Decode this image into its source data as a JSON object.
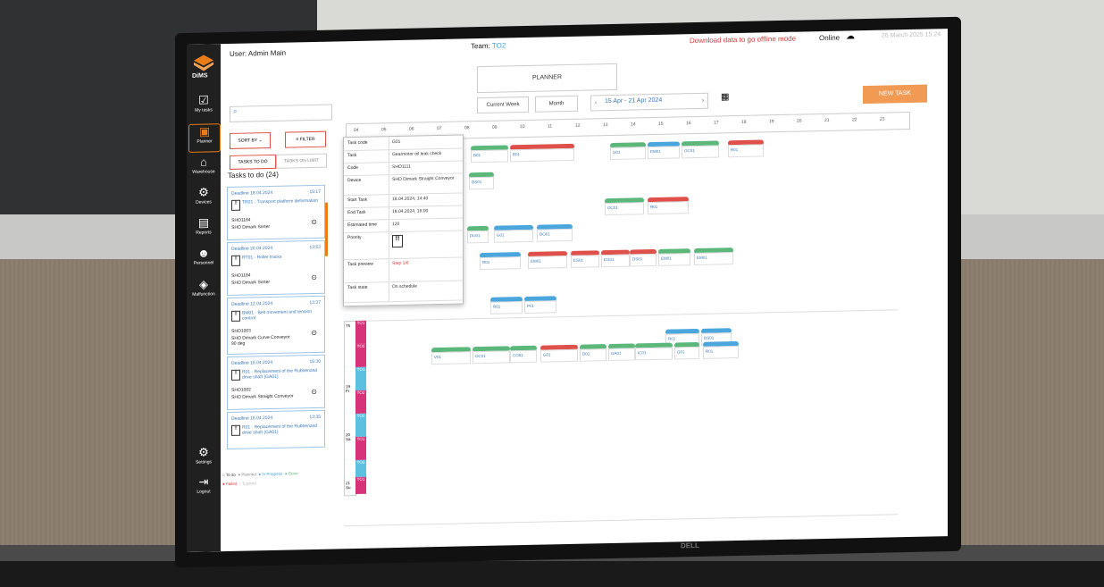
{
  "app": {
    "logo_text": "DiMS",
    "user": "User: Admin Main",
    "team_label": "Team:",
    "team_value": "TO2",
    "offline_text": "Download data to go offline mode",
    "online_text": "Online",
    "datetime": "26 March 2025 15:24",
    "brand_color": "#e97d1a"
  },
  "nav": [
    {
      "label": "My tasks",
      "icon": "checklist-icon"
    },
    {
      "label": "Planner",
      "icon": "calendar-icon"
    },
    {
      "label": "Warehouse",
      "icon": "warehouse-icon"
    },
    {
      "label": "Devices",
      "icon": "gears-icon"
    },
    {
      "label": "Reports",
      "icon": "document-icon"
    },
    {
      "label": "Personnel",
      "icon": "people-icon"
    },
    {
      "label": "Malfunction",
      "icon": "warning-icon"
    },
    {
      "label": "Settings",
      "icon": "gear-icon"
    },
    {
      "label": "Logout",
      "icon": "logout-icon"
    }
  ],
  "toolbar": {
    "planner_tab": "PLANNER",
    "current_week": "Current Week",
    "month": "Month",
    "range": "15 Apr - 21 Apr 2024",
    "new_task": "NEW TASK"
  },
  "left": {
    "sort_by": "SORT BY",
    "filter": "FILTER",
    "tab_todo": "TASKS TO DO",
    "tab_nolimit": "TASKS ON LIMIT",
    "tasks_heading": "Tasks to do (24)",
    "cards": [
      {
        "deadline": "Deadline 18.04.2024",
        "time": "15:17",
        "title": "TR01 - Transport platform deformation",
        "code": "SHO1184",
        "device": "SHO Dimark Sorter"
      },
      {
        "deadline": "Deadline 20.04.2024",
        "time": "13:53",
        "title": "RT01 - Roller tracks",
        "code": "SHO1184",
        "device": "SHO Dimark Sorter"
      },
      {
        "deadline": "Deadline 12.04.2024",
        "time": "13:37",
        "title": "BM01 - Belt movement and tension control",
        "code": "SHO1003",
        "device": "SHO Dimark Curve Conveyor 90 deg"
      },
      {
        "deadline": "Deadline 15.04.2024",
        "time": "16:30",
        "title": "R01 - Replacement of the Rubberized drive shaft (GA01)",
        "code": "SHO1002",
        "device": "SHO Dimark Straight Conveyor"
      },
      {
        "deadline": "Deadline 16.04.2024",
        "time": "13:35",
        "title": "R01 - Replacement of the Rubberized drive shaft (GA01)",
        "code": "",
        "device": ""
      }
    ],
    "legend": [
      "To do",
      "Planned",
      "In Progress",
      "Done",
      "Failed",
      "Expired"
    ]
  },
  "hours": [
    "04",
    "05",
    "06",
    "07",
    "08",
    "09",
    "10",
    "11",
    "12",
    "13",
    "14",
    "15",
    "16",
    "17",
    "18",
    "19",
    "20",
    "21",
    "22",
    "23"
  ],
  "popover": {
    "rows": [
      {
        "k": "Task code",
        "v": "G01"
      },
      {
        "k": "Task",
        "v": "Gearmotor oil leak check"
      },
      {
        "k": "Code",
        "v": "SHO1111"
      },
      {
        "k": "Device",
        "v": "SHO Dimark Straight Conveyor"
      },
      {
        "k": "Start Task",
        "v": "18.04.2024, 14:40"
      },
      {
        "k": "End Task",
        "v": "18.04.2024, 16:00"
      },
      {
        "k": "Estimated time",
        "v": "120"
      },
      {
        "k": "Priority",
        "v": ""
      },
      {
        "k": "Task preview",
        "v": "Step 1/6"
      },
      {
        "k": "Task state",
        "v": "On schedule"
      }
    ]
  },
  "blocks": [
    {
      "t": "B01"
    },
    {
      "t": "B01"
    },
    {
      "t": "G01"
    },
    {
      "t": "EM01"
    },
    {
      "t": "OC01"
    },
    {
      "t": "R01"
    },
    {
      "t": "DS01"
    },
    {
      "t": "OC01"
    },
    {
      "t": "R01"
    },
    {
      "t": "DU01"
    },
    {
      "t": "G01"
    },
    {
      "t": "DO01"
    },
    {
      "t": "R01"
    },
    {
      "t": "EM01"
    },
    {
      "t": "ES01"
    },
    {
      "t": "EG01"
    },
    {
      "t": "DS01"
    },
    {
      "t": "EM01"
    },
    {
      "t": "EM01"
    },
    {
      "t": "R01"
    },
    {
      "t": "P01"
    },
    {
      "t": "R01"
    },
    {
      "t": "DS01"
    },
    {
      "t": "V01"
    },
    {
      "t": "OC01"
    },
    {
      "t": "CO01"
    },
    {
      "t": "G01"
    },
    {
      "t": "D01"
    },
    {
      "t": "GA01"
    },
    {
      "t": "IC01"
    },
    {
      "t": "G01"
    },
    {
      "t": "R01"
    }
  ],
  "days": [
    {
      "label": "Th",
      "teams": [
        "TO1",
        "TO2"
      ]
    },
    {
      "label": "19 Fr",
      "teams": [
        "TO1",
        "TO2"
      ]
    },
    {
      "label": "20 Sa",
      "teams": [
        "TO2",
        "TO1"
      ]
    },
    {
      "label": "21 Su",
      "teams": [
        "TO2",
        "TO1"
      ]
    }
  ]
}
